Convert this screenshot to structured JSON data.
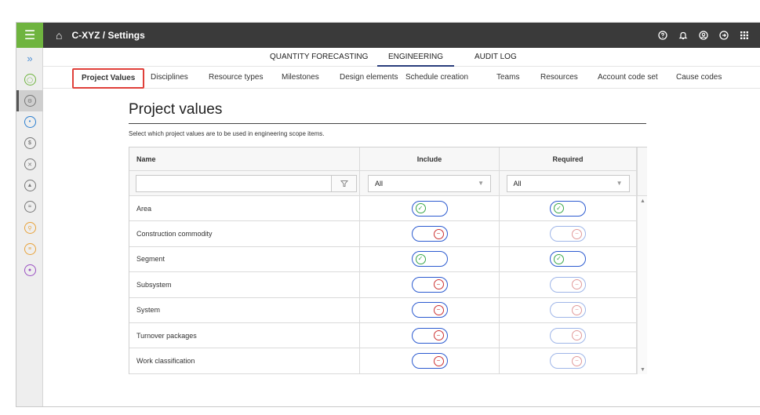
{
  "topbar": {
    "breadcrumb": "C-XYZ / Settings",
    "accent_color": "#6fb43f",
    "bar_color": "#3a3a3a"
  },
  "module_tabs": [
    {
      "label": "QUANTITY FORECASTING",
      "active": false
    },
    {
      "label": "ENGINEERING",
      "active": true
    },
    {
      "label": "AUDIT LOG",
      "active": false
    }
  ],
  "sub_tabs": [
    {
      "label": "Project Values",
      "active": true
    },
    {
      "label": "Disciplines"
    },
    {
      "label": "Resource types"
    },
    {
      "label": "Milestones"
    },
    {
      "label": "Design elements"
    },
    {
      "label": "Schedule creation"
    },
    {
      "label": "Teams"
    },
    {
      "label": "Resources"
    },
    {
      "label": "Account code set"
    },
    {
      "label": "Cause codes"
    }
  ],
  "page": {
    "title": "Project values",
    "subtitle": "Select which project values are to be used in engineering scope items."
  },
  "grid": {
    "columns": [
      "Name",
      "Include",
      "Required"
    ],
    "filters": {
      "name_value": "",
      "include_value": "All",
      "required_value": "All"
    },
    "rows": [
      {
        "name": "Area",
        "include": true,
        "required": true
      },
      {
        "name": "Construction commodity",
        "include": false,
        "required": false
      },
      {
        "name": "Segment",
        "include": true,
        "required": true
      },
      {
        "name": "Subsystem",
        "include": false,
        "required": false
      },
      {
        "name": "System",
        "include": false,
        "required": false
      },
      {
        "name": "Turnover packages",
        "include": false,
        "required": false
      },
      {
        "name": "Work classification",
        "include": false,
        "required": false
      }
    ]
  }
}
